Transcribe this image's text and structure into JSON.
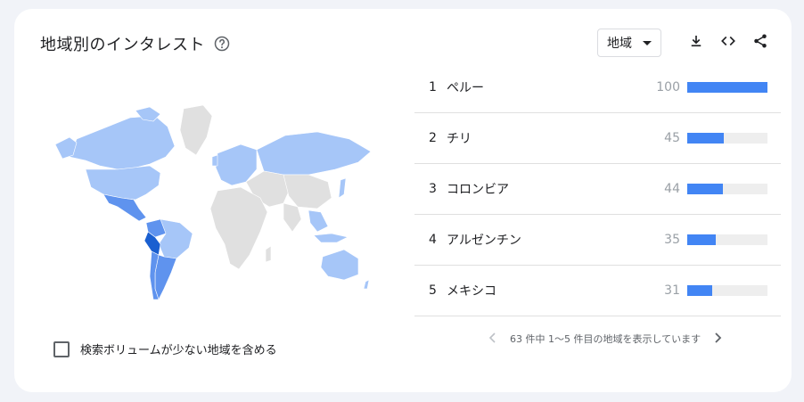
{
  "header": {
    "title": "地域別のインタレスト",
    "help_icon": "help-circle-icon",
    "select_label": "地域",
    "icons": [
      "download-icon",
      "embed-code-icon",
      "share-icon"
    ]
  },
  "colors": {
    "accent": "#4285f4",
    "map_dark": "#1a5fd0",
    "map_mid": "#5f93ee",
    "map_light": "#a6c6f8",
    "map_none": "#e0e0e0"
  },
  "options": {
    "low_volume_label": "検索ボリュームが少ない地域を含める"
  },
  "regions": [
    {
      "rank": "1",
      "name": "ペルー",
      "value": 100
    },
    {
      "rank": "2",
      "name": "チリ",
      "value": 45
    },
    {
      "rank": "3",
      "name": "コロンビア",
      "value": 44
    },
    {
      "rank": "4",
      "name": "アルゼンチン",
      "value": 35
    },
    {
      "rank": "5",
      "name": "メキシコ",
      "value": 31
    }
  ],
  "pagination": {
    "text": "63 件中 1〜5 件目の地域を表示しています"
  }
}
